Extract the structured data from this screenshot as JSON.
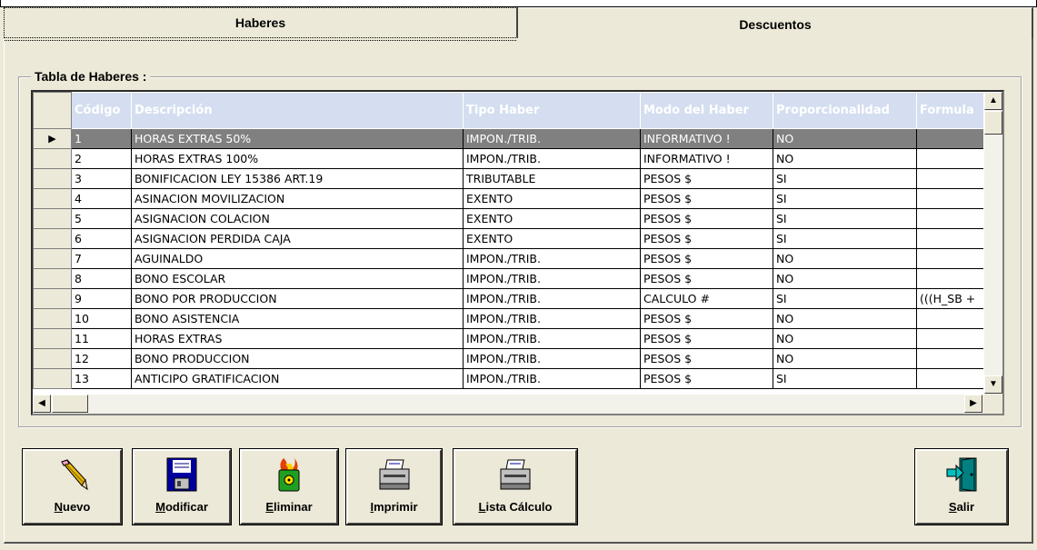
{
  "tabs": [
    {
      "label": "Haberes",
      "active": true
    },
    {
      "label": "Descuentos",
      "active": false
    }
  ],
  "group_title": "Tabla de Haberes :",
  "columns": [
    "Código",
    "Descripción",
    "Tipo Haber",
    "Modo del Haber",
    "Proporcionalidad",
    "Formula"
  ],
  "rows": [
    {
      "codigo": "1",
      "descripcion": "HORAS EXTRAS 50%",
      "tipo": "IMPON./TRIB.",
      "modo": "INFORMATIVO !",
      "prop": "NO",
      "formula": ""
    },
    {
      "codigo": "2",
      "descripcion": "HORAS EXTRAS 100%",
      "tipo": "IMPON./TRIB.",
      "modo": "INFORMATIVO !",
      "prop": "NO",
      "formula": ""
    },
    {
      "codigo": "3",
      "descripcion": "BONIFICACION LEY 15386 ART.19",
      "tipo": "TRIBUTABLE",
      "modo": "PESOS $",
      "prop": "SI",
      "formula": ""
    },
    {
      "codigo": "4",
      "descripcion": "ASINACION MOVILIZACION",
      "tipo": "EXENTO",
      "modo": "PESOS $",
      "prop": "SI",
      "formula": ""
    },
    {
      "codigo": "5",
      "descripcion": "ASIGNACION COLACION",
      "tipo": "EXENTO",
      "modo": "PESOS $",
      "prop": "SI",
      "formula": ""
    },
    {
      "codigo": "6",
      "descripcion": "ASIGNACION PERDIDA CAJA",
      "tipo": "EXENTO",
      "modo": "PESOS $",
      "prop": "SI",
      "formula": ""
    },
    {
      "codigo": "7",
      "descripcion": "AGUINALDO",
      "tipo": "IMPON./TRIB.",
      "modo": "PESOS $",
      "prop": "NO",
      "formula": ""
    },
    {
      "codigo": "8",
      "descripcion": "BONO ESCOLAR",
      "tipo": "IMPON./TRIB.",
      "modo": "PESOS $",
      "prop": "NO",
      "formula": ""
    },
    {
      "codigo": "9",
      "descripcion": "BONO POR PRODUCCION",
      "tipo": "IMPON./TRIB.",
      "modo": "CALCULO #",
      "prop": "SI",
      "formula": "(((H_SB +"
    },
    {
      "codigo": "10",
      "descripcion": "BONO ASISTENCIA",
      "tipo": "IMPON./TRIB.",
      "modo": "PESOS $",
      "prop": "NO",
      "formula": ""
    },
    {
      "codigo": "11",
      "descripcion": "HORAS EXTRAS",
      "tipo": "IMPON./TRIB.",
      "modo": "PESOS $",
      "prop": "NO",
      "formula": ""
    },
    {
      "codigo": "12",
      "descripcion": "BONO PRODUCCION",
      "tipo": "IMPON./TRIB.",
      "modo": "PESOS $",
      "prop": "NO",
      "formula": ""
    },
    {
      "codigo": "13",
      "descripcion": "ANTICIPO GRATIFICACION",
      "tipo": "IMPON./TRIB.",
      "modo": "PESOS $",
      "prop": "SI",
      "formula": ""
    }
  ],
  "selected_row_indicator": "▶",
  "buttons": {
    "nuevo": {
      "accel": "N",
      "rest": "uevo"
    },
    "modificar": {
      "accel": "M",
      "rest": "odificar"
    },
    "eliminar": {
      "accel": "E",
      "rest": "liminar"
    },
    "imprimir": {
      "accel": "I",
      "rest": "mprimir"
    },
    "lista": {
      "accel": "L",
      "rest": "ista Cálculo"
    },
    "salir": {
      "accel": "S",
      "rest": "alir"
    }
  },
  "colors": {
    "header_bg": "#d4def0",
    "selected_bg": "#808080",
    "window_bg": "#ece9d8"
  },
  "icons": {
    "nuevo": "pencil-icon",
    "modificar": "floppy-disk-icon",
    "eliminar": "trash-fire-icon",
    "imprimir": "printer-icon",
    "lista": "printer-icon",
    "salir": "exit-door-icon"
  }
}
